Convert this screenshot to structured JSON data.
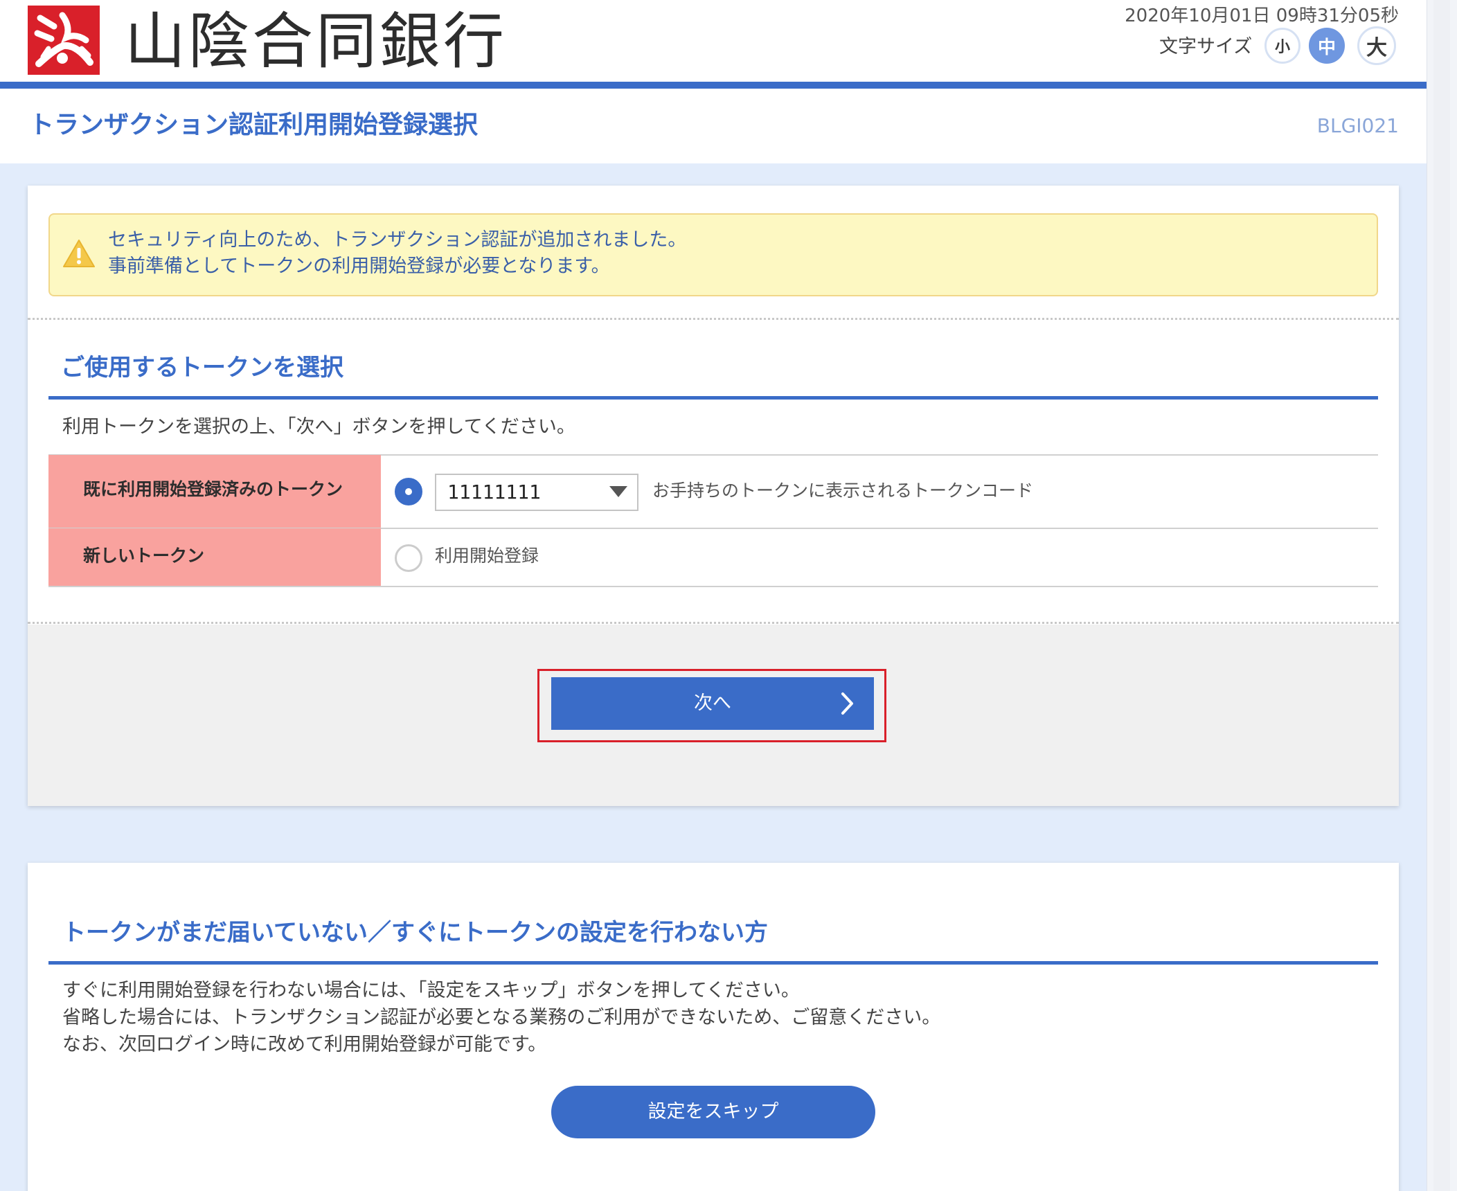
{
  "header": {
    "bank_name": "山陰合同銀行",
    "datetime": "2020年10月01日 09時31分05秒",
    "font_size_label": "文字サイズ",
    "font_size_options": [
      "小",
      "中",
      "大"
    ],
    "font_size_selected": "中",
    "brand_color": "#d9202a"
  },
  "title_bar": {
    "title": "トランザクション認証利用開始登録選択",
    "screen_id": "BLGI021"
  },
  "notice": {
    "icon": "warning-icon",
    "line1": "セキュリティ向上のため、トランザクション認証が追加されました。",
    "line2": "事前準備としてトークンの利用開始登録が必要となります。"
  },
  "token_section": {
    "title": "ご使用するトークンを選択",
    "instruction": "利用トークンを選択の上、「次へ」ボタンを押してください。",
    "rows": [
      {
        "label": "既に利用開始登録済みのトークン",
        "selected": true,
        "select_value": "11111111",
        "hint": "お手持ちのトークンに表示されるトークンコード"
      },
      {
        "label": "新しいトークン",
        "selected": false,
        "option_label": "利用開始登録"
      }
    ],
    "next_button": "次へ"
  },
  "skip_section": {
    "title": "トークンがまだ届いていない／すぐにトークンの設定を行わない方",
    "notes": [
      "すぐに利用開始登録を行わない場合には、「設定をスキップ」ボタンを押してください。",
      "省略した場合には、トランザクション認証が必要となる業務のご利用ができないため、ご留意ください。",
      "なお、次回ログイン時に改めて利用開始登録が可能です。"
    ],
    "skip_button": "設定をスキップ"
  },
  "colors": {
    "accent": "#3a6cc8",
    "table_header": "#f9a29e",
    "notice_bg": "#fdf8c2",
    "focus_outline": "#d9202a"
  }
}
